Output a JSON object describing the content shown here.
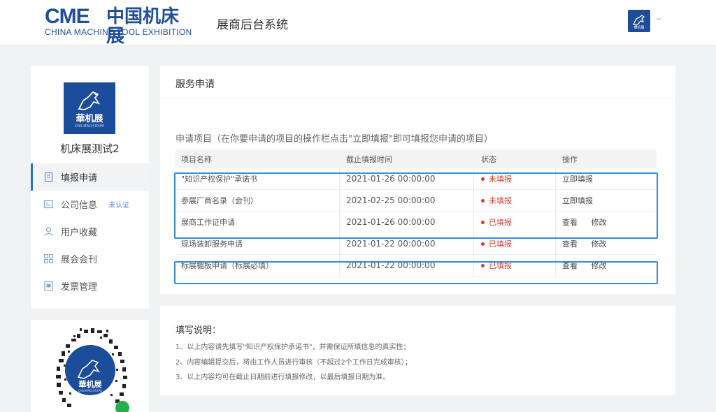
{
  "header": {
    "logo_mark": "CME",
    "logo_cn": "中国机床展",
    "logo_en": "CHINA MACHINE TOOL EXHIBITION",
    "system_title": "展商后台系统",
    "avatar_text": "華机展"
  },
  "sidebar": {
    "logo_text": "華机展",
    "logo_sub": "CHN MACH EXPO",
    "company_name": "机床展测试2",
    "items": [
      {
        "label": "填报申请",
        "icon": "document-icon",
        "active": true
      },
      {
        "label": "公司信息",
        "icon": "company-icon",
        "badge": "未认证"
      },
      {
        "label": "用户收藏",
        "icon": "user-icon"
      },
      {
        "label": "展会会刊",
        "icon": "grid-icon"
      },
      {
        "label": "发票管理",
        "icon": "invoice-icon"
      }
    ],
    "qr_logo_text": "華机展",
    "qr_logo_sub": "CHN MACH EXPO"
  },
  "main": {
    "title": "服务申请",
    "hint": "申请项目（在你要申请的项目的操作栏点击\"立即填报\"即可填报您申请的项目）",
    "columns": [
      "项目名称",
      "截止填报时间",
      "状态",
      "操作"
    ],
    "rows": [
      {
        "name": "\"知识产权保护\"承诺书",
        "deadline": "2021-01-26 00:00:00",
        "status": "未填报",
        "actions": [
          "立即填报"
        ]
      },
      {
        "name": "参展厂商名录（会刊）",
        "deadline": "2021-02-25 00:00:00",
        "status": "未填报",
        "actions": [
          "立即填报"
        ]
      },
      {
        "name": "展商工作证申请",
        "deadline": "2021-01-26 00:00:00",
        "status": "已填报",
        "actions": [
          "查看",
          "修改"
        ]
      },
      {
        "name": "现场装卸服务申请",
        "deadline": "2021-01-22 00:00:00",
        "status": "已填报",
        "actions": [
          "查看",
          "修改"
        ]
      },
      {
        "name": "标展楣板申请（标展必填）",
        "deadline": "2021-01-22 00:00:00",
        "status": "已填报",
        "actions": [
          "查看",
          "修改"
        ]
      }
    ]
  },
  "notes": {
    "title": "填写说明：",
    "lines": [
      "1、以上内容请先填写\"知识产权保护承诺书\"，并需保证所填信息的真实性；",
      "2、内容编辑提交后，将由工作人员进行审核（不超过2个工作日完成审核）；",
      "3、以上内容均可在截止日期前进行填报修改，以最后填报日期为准。"
    ]
  },
  "colors": {
    "brand": "#1f4e9c",
    "status_red": "#d93a2f",
    "highlight": "#2f8fe0"
  }
}
